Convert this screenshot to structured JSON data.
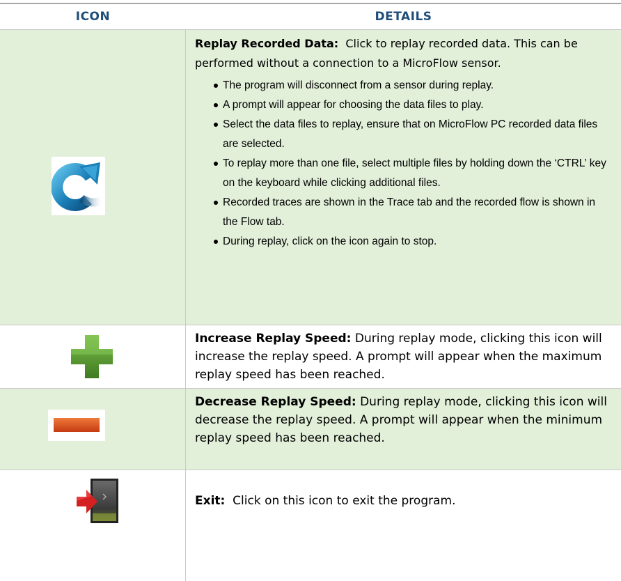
{
  "header": {
    "icon_col": "ICON",
    "details_col": "DETAILS"
  },
  "rows": [
    {
      "icon": "replay-arrow-icon",
      "title": "Replay Recorded Data:",
      "text": "Click to replay recorded data.  This can be performed without a connection to a MicroFlow sensor.",
      "bullets": [
        "The program will disconnect from a sensor during replay.",
        "A prompt will appear for choosing the data files to play.",
        "Select the data files to replay, ensure that on MicroFlow PC recorded data files are selected.",
        "To replay more than one file, select multiple files by holding down the ‘CTRL’ key on the keyboard while clicking additional files.",
        "Recorded traces are shown in the Trace tab and the recorded flow is shown in the Flow tab.",
        "During replay, click on the icon again to stop."
      ]
    },
    {
      "icon": "plus-icon",
      "title": "Increase Replay Speed:",
      "text": "During replay mode, clicking this icon will increase the replay speed.  A prompt will appear when the maximum replay speed has been reached."
    },
    {
      "icon": "minus-icon",
      "title": "Decrease Replay Speed:",
      "text": "During replay mode, clicking this icon will decrease the replay speed.  A prompt will appear when the minimum replay speed has been reached."
    },
    {
      "icon": "exit-door-icon",
      "title": "Exit:",
      "text": "Click on this icon to exit the program."
    }
  ],
  "colors": {
    "header_text": "#1f4e79",
    "row_shade": "#e2efd9",
    "rule": "#a6a6a6",
    "plus_green": "#5a9a32",
    "minus_orange": "#d8501e",
    "replay_blue": "#1b7fb8",
    "exit_red": "#d42020"
  }
}
